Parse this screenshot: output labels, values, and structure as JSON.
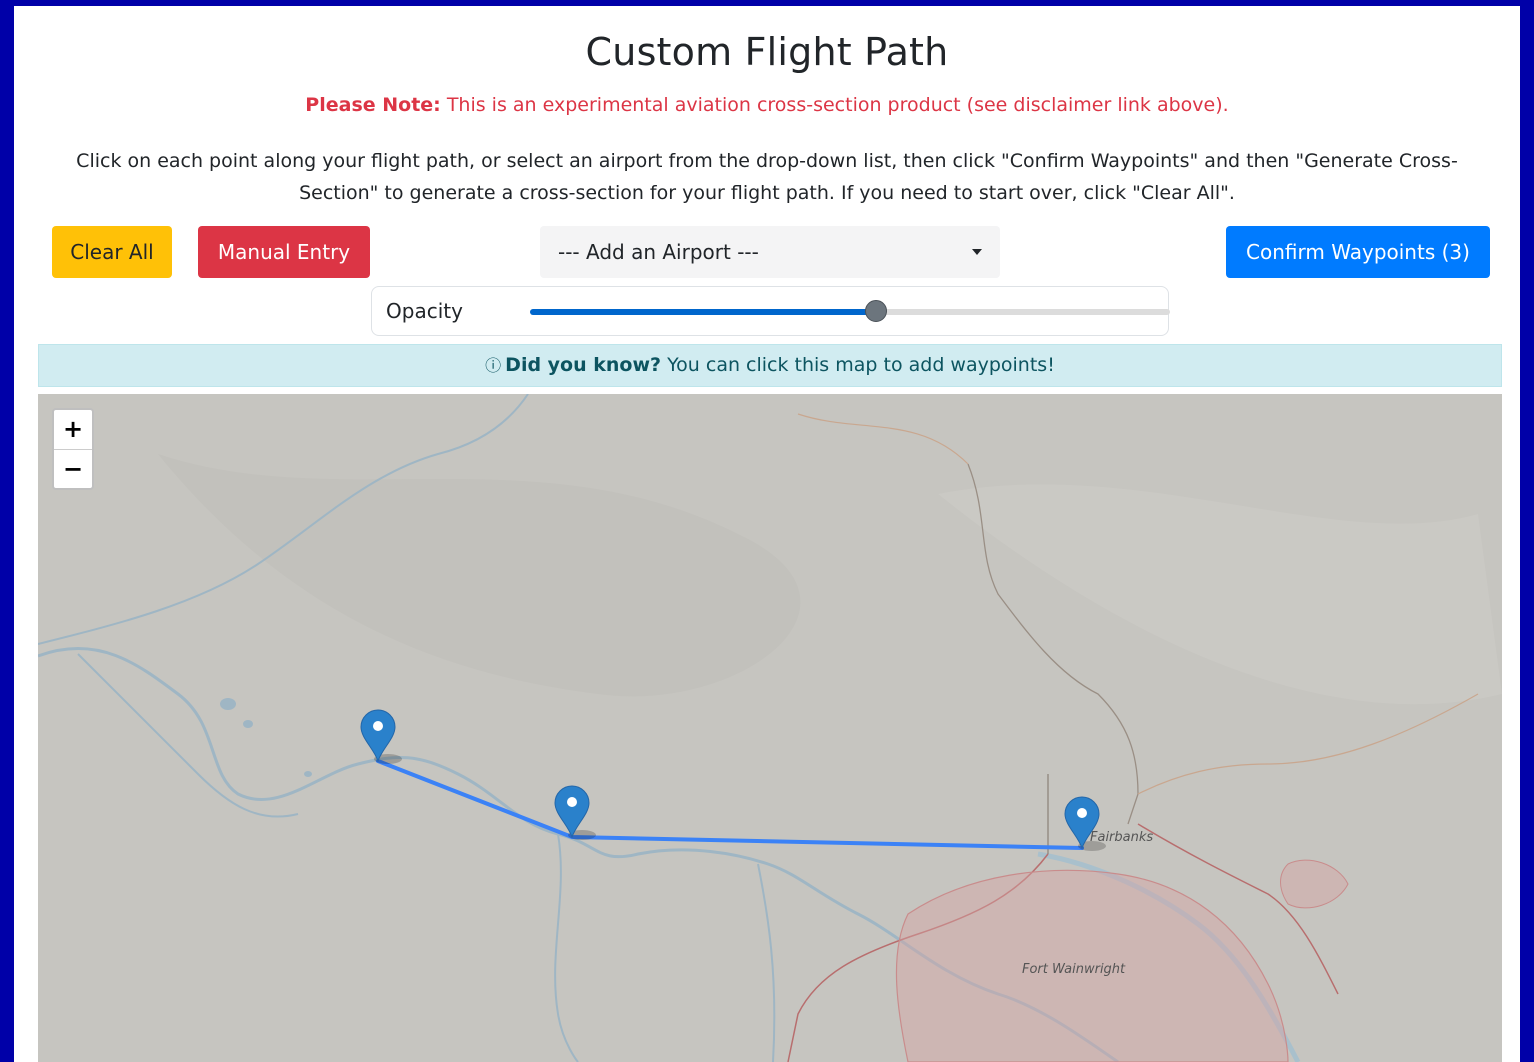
{
  "page": {
    "title": "Custom Flight Path",
    "note_bold": "Please Note:",
    "note_text": " This is an experimental aviation cross-section product (see disclaimer link above).",
    "instructions": "Click on each point along your flight path, or select an airport from the drop-down list, then click \"Confirm Waypoints\" and then \"Generate Cross-Section\" to generate a cross-section for your flight path. If you need to start over, click \"Clear All\"."
  },
  "toolbar": {
    "clear_label": "Clear All",
    "manual_label": "Manual Entry",
    "airport_select_value": "--- Add an Airport ---",
    "confirm_label": "Confirm Waypoints (3)"
  },
  "opacity": {
    "label": "Opacity",
    "value": 0.54
  },
  "tip": {
    "icon": "ⓘ",
    "bold": "Did you know?",
    "text": " You can click this map to add waypoints!"
  },
  "map": {
    "zoom_in": "+",
    "zoom_out": "−",
    "labels": {
      "fairbanks": "Fairbanks",
      "fort_wainwright": "Fort Wainwright"
    },
    "colors": {
      "route": "#3b82f6",
      "marker": "#2a81cb",
      "water": "#9fb6c4",
      "restricted": "#d4a5a5"
    }
  }
}
